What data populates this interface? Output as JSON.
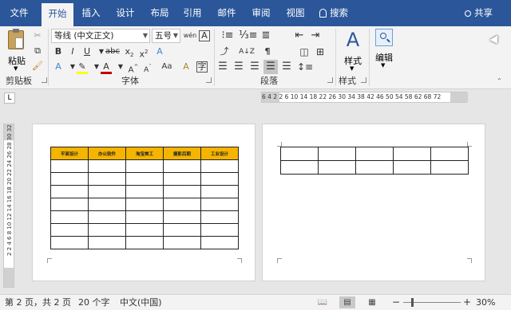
{
  "tabs": [
    {
      "label": "文件",
      "active": false
    },
    {
      "label": "开始",
      "active": true
    },
    {
      "label": "插入",
      "active": false
    },
    {
      "label": "设计",
      "active": false
    },
    {
      "label": "布局",
      "active": false
    },
    {
      "label": "引用",
      "active": false
    },
    {
      "label": "邮件",
      "active": false
    },
    {
      "label": "审阅",
      "active": false
    },
    {
      "label": "视图",
      "active": false
    }
  ],
  "search_label": "搜索",
  "share_label": "共享",
  "ribbon": {
    "clipboard": {
      "paste_label": "粘贴",
      "group_label": "剪贴板"
    },
    "font": {
      "font_name": "等线 (中文正文)",
      "font_size": "五号",
      "group_label": "字体"
    },
    "paragraph": {
      "group_label": "段落"
    },
    "styles": {
      "button_label": "样式",
      "group_label": "样式"
    },
    "editing": {
      "button_label": "编辑"
    }
  },
  "ruler_numbers": "6 4 2 2 6 10 14 18 22 26 30 34 38 42 46 50 54 58 62 68 72",
  "vruler_numbers": "2 2 4 6 8 10 12 14 16 18 20 22 24 26 28 30 32",
  "document": {
    "headers": [
      "平面设计",
      "办公软件",
      "淘宝美工",
      "摄影后期",
      "工业设计"
    ],
    "page1_body_rows": 7,
    "page2_rows": 2
  },
  "status": {
    "page_info": "第 2 页，共 2 页",
    "word_count": "20 个字",
    "language": "中文(中国)",
    "zoom": "30%",
    "zoom_fraction": 0.3
  },
  "colors": {
    "brand": "#2b579a",
    "header_fill": "#f4b400",
    "font_color": "#c00000",
    "highlight": "#ffff00"
  }
}
